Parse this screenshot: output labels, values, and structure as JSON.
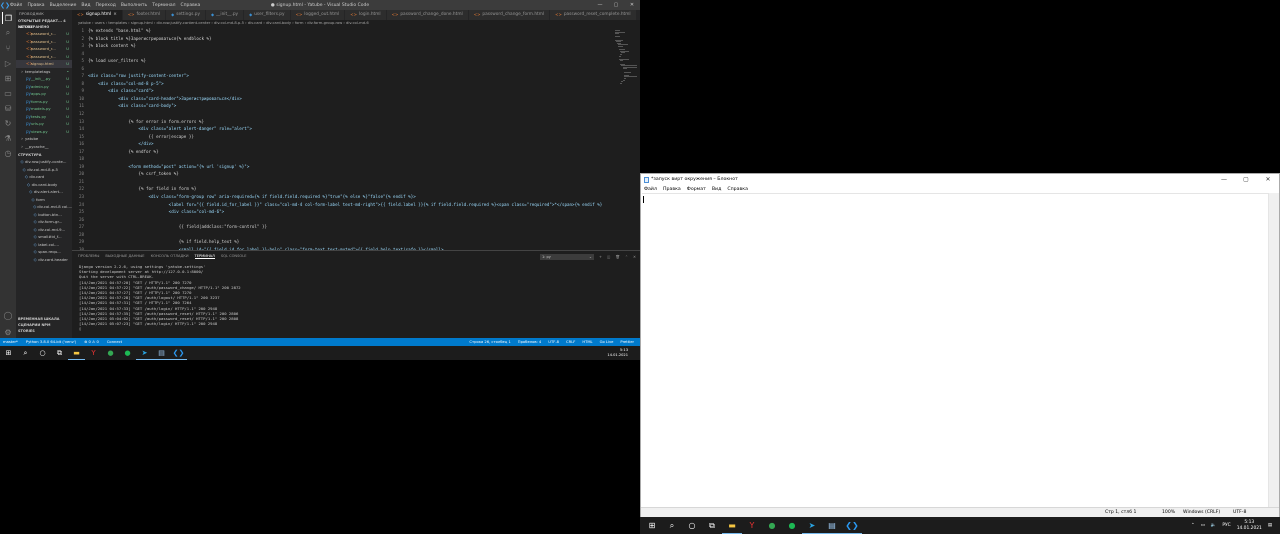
{
  "vscode": {
    "menu": [
      "Файл",
      "Правка",
      "Выделение",
      "Вид",
      "Переход",
      "Выполнить",
      "Терминал",
      "Справка"
    ],
    "window_title": "● signup.html - Yatube - Visual Studio Code",
    "sidebar": {
      "explorer_title": "ПРОВОДНИК",
      "open_editors": "ОТКРЫТЫЕ РЕДАКТ... 4 НЕ СОХРАНЕНО",
      "project": "YATUBE",
      "files": [
        {
          "icon": "<>",
          "label": "password_r...",
          "mark": "U"
        },
        {
          "icon": "<>",
          "label": "password_r...",
          "mark": "U"
        },
        {
          "icon": "<>",
          "label": "password_r...",
          "mark": "U"
        },
        {
          "icon": "<>",
          "label": "password_r...",
          "mark": "U"
        },
        {
          "icon": "<>",
          "label": "signup.html",
          "mark": "U"
        },
        {
          "icon": "›",
          "label": "templatetags",
          "mark": "•"
        },
        {
          "icon": "py",
          "label": "__init__.py",
          "mark": "U"
        },
        {
          "icon": "py",
          "label": "admin.py",
          "mark": "U"
        },
        {
          "icon": "py",
          "label": "apps.py",
          "mark": "U"
        },
        {
          "icon": "py",
          "label": "forms.py",
          "mark": "U"
        },
        {
          "icon": "py",
          "label": "models.py",
          "mark": "U"
        },
        {
          "icon": "py",
          "label": "tests.py",
          "mark": "U"
        },
        {
          "icon": "py",
          "label": "urls.py",
          "mark": "U"
        },
        {
          "icon": "py",
          "label": "views.py",
          "mark": "U"
        },
        {
          "icon": "›",
          "label": "yatube",
          "mark": ""
        },
        {
          "icon": "›",
          "label": "__pycache__",
          "mark": ""
        }
      ],
      "structure_title": "СТРУКТУРА",
      "structure": [
        "div.row.justify-conte...",
        "div.col-md-8.p-5",
        "div.card",
        "div.card-body",
        "div.alert.alert...",
        "form",
        "div.col-md-8 col-...",
        "button.btn...",
        "div.form-gr...",
        "div.col-md-9...",
        "small#id_f...",
        "label.col-...",
        "span.requ...",
        "div.card-header"
      ],
      "bottom_sections": [
        "ВРЕМЕННАЯ ШКАЛА",
        "СЦЕНАРИИ NPM",
        "STORIES"
      ]
    },
    "tabs": [
      {
        "label": "signup.html",
        "active": true
      },
      {
        "label": "footer.html",
        "active": false
      },
      {
        "label": "settings.py",
        "active": false
      },
      {
        "label": "__init__.py",
        "active": false
      },
      {
        "label": "user_filters.py",
        "active": false
      },
      {
        "label": "logged_out.html",
        "active": false
      },
      {
        "label": "login.html",
        "active": false
      },
      {
        "label": "password_change_done.html",
        "active": false
      },
      {
        "label": "password_change_form.html",
        "active": false
      },
      {
        "label": "password_reset_complete.html",
        "active": false
      }
    ],
    "breadcrumb": "yatube › users › templates › signup.html › div.row.justify-content-center › div.col-md-8.p-5 › div.card › div.card-body › form › div.form-group.row › div.col-md-6",
    "code_lines": [
      {
        "n": "1",
        "t": "{% extends \"base.html\" %}"
      },
      {
        "n": "2",
        "t": "{% block title %}Зарегистрироваться{% endblock %}"
      },
      {
        "n": "3",
        "t": "{% block content %}"
      },
      {
        "n": "4",
        "t": ""
      },
      {
        "n": "5",
        "t": "{% load user_filters %}"
      },
      {
        "n": "6",
        "t": ""
      },
      {
        "n": "7",
        "t": "<div class=\"row justify-content-center\">"
      },
      {
        "n": "8",
        "t": "    <div class=\"col-md-8 p-5\">"
      },
      {
        "n": "9",
        "t": "        <div class=\"card\">"
      },
      {
        "n": "10",
        "t": "            <div class=\"card-header\">Зарегистрироваться</div>"
      },
      {
        "n": "11",
        "t": "            <div class=\"card-body\">"
      },
      {
        "n": "12",
        "t": ""
      },
      {
        "n": "13",
        "t": "                {% for error in form.errors %}"
      },
      {
        "n": "14",
        "t": "                    <div class=\"alert alert-danger\" role=\"alert\">"
      },
      {
        "n": "15",
        "t": "                        {{ error|escape }}"
      },
      {
        "n": "16",
        "t": "                    </div>"
      },
      {
        "n": "17",
        "t": "                {% endfor %}"
      },
      {
        "n": "18",
        "t": ""
      },
      {
        "n": "19",
        "t": "                <form method=\"post\" action=\"{% url 'signup' %}\">"
      },
      {
        "n": "20",
        "t": "                    {% csrf_token %}"
      },
      {
        "n": "21",
        "t": ""
      },
      {
        "n": "22",
        "t": "                    {% for field in form %}"
      },
      {
        "n": "23",
        "t": "                        <div class=\"form-group row\" aria-required={% if field.field.required %}\"true\"{% else %}\"false\"{% endif %}>"
      },
      {
        "n": "24",
        "t": "                                <label for=\"{{ field.id_for_label }}\" class=\"col-md-4 col-form-label text-md-right\">{{ field.label }}{% if field.field.required %}<span class=\"required\">*</span>{% endif %}"
      },
      {
        "n": "25",
        "t": "                                <div class=\"col-md-6\">"
      },
      {
        "n": "26",
        "t": ""
      },
      {
        "n": "27",
        "t": "                                    {{ field|addclass:\"form-control\" }}"
      },
      {
        "n": "28",
        "t": ""
      },
      {
        "n": "29",
        "t": "                                    {% if field.help_text %}"
      },
      {
        "n": "30",
        "t": "                                    <small id=\"{{ field.id_for_label }}-help\" class=\"form-text text-muted\">{{ field.help_text|safe }}</small>"
      },
      {
        "n": "31",
        "t": "                                    {% endif %}"
      },
      {
        "n": "32",
        "t": "                                </div>"
      },
      {
        "n": "33",
        "t": "                        </div>"
      },
      {
        "n": "34",
        "t": "                    {% endfor %}"
      }
    ],
    "panel": {
      "tabs": [
        "ПРОБЛЕМЫ",
        "ВЫХОДНЫЕ ДАННЫЕ",
        "КОНСОЛЬ ОТЛАДКИ",
        "ТЕРМИНАЛ",
        "SQL CONSOLE"
      ],
      "active_tab": "ТЕРМИНАЛ",
      "terminal_select": "1: py",
      "terminal_lines": [
        "Django version 2.2.6, using settings 'yatube.settings'",
        "Starting development server at http://127.0.0.1:8000/",
        "Quit the server with CTRL-BREAK.",
        "[14/Jan/2021 04:57:20] \"GET / HTTP/1.1\" 200 7270",
        "[14/Jan/2021 04:57:22] \"GET /auth/password_change/ HTTP/1.1\" 200 2872",
        "[14/Jan/2021 04:57:27] \"GET / HTTP/1.1\" 200 7270",
        "[14/Jan/2021 04:57:28] \"GET /auth/logout/ HTTP/1.1\" 200 3237",
        "[14/Jan/2021 04:57:31] \"GET / HTTP/1.1\" 200 7264",
        "[14/Jan/2021 04:57:33] \"GET /auth/login/ HTTP/1.1\" 200 2948",
        "[14/Jan/2021 04:57:35] \"GET /auth/password_reset/ HTTP/1.1\" 200 2806",
        "[14/Jan/2021 05:04:02] \"GET /auth/password_reset/ HTTP/1.1\" 200 2808",
        "[14/Jan/2021 05:07:23] \"GET /auth/login/ HTTP/1.1\" 200 2948",
        "▯"
      ]
    },
    "status": {
      "left": [
        "master*",
        "Python 3.8.0 64-bit ('venv')",
        "⊗ 0 ⚠ 0",
        "Connect"
      ],
      "right": [
        "Строка 26, столбец 1",
        "Пробелов: 4",
        "UTF-8",
        "CRLF",
        "HTML",
        "Go Live",
        "Prettier"
      ]
    }
  },
  "taskbar_left": {
    "icons": [
      "windows-start-icon",
      "search-icon",
      "cortana-icon",
      "task-view-icon",
      "file-explorer-icon",
      "yandex-browser-icon",
      "chrome-icon",
      "spotify-icon",
      "telegram-icon",
      "notepad-icon",
      "vscode-icon"
    ],
    "time": "5:13",
    "date": "14.01.2021"
  },
  "notepad": {
    "title": "*запуск вирт окружения – Блокнот",
    "menu": [
      "Файл",
      "Правка",
      "Формат",
      "Вид",
      "Справка"
    ],
    "status": {
      "position": "Стр 1, стлб 1",
      "zoom": "100%",
      "line_ending": "Windows (CRLF)",
      "encoding": "UTF-8"
    }
  },
  "taskbar_right": {
    "icons": [
      "windows-start-icon",
      "search-icon",
      "cortana-icon",
      "task-view-icon",
      "file-explorer-icon",
      "yandex-browser-icon",
      "chrome-icon",
      "spotify-icon",
      "telegram-icon",
      "notepad-icon",
      "vscode-icon"
    ],
    "language": "РУС",
    "time": "5:13",
    "date": "14.01.2021"
  },
  "colors": {
    "vscode_status": "#007acc",
    "vscode_bg": "#1e1e1e",
    "taskbar": "#1c1c1c"
  }
}
